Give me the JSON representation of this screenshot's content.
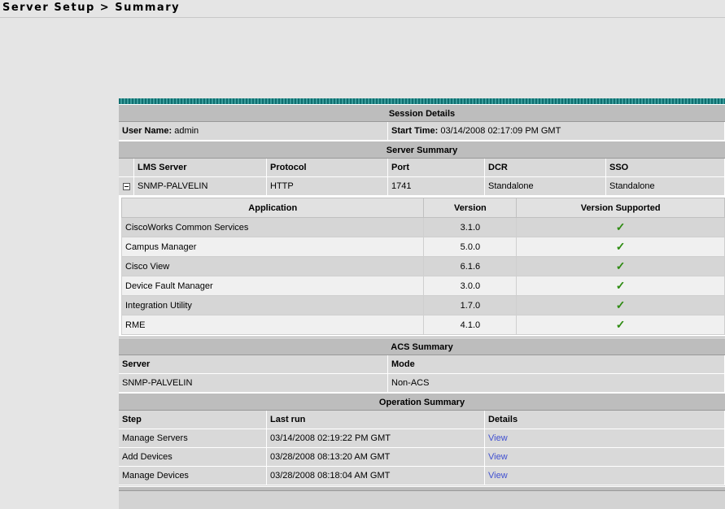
{
  "breadcrumb": "Server Setup > Summary",
  "session": {
    "title": "Session Details",
    "user_label": "User Name:",
    "user_value": "admin",
    "start_label": "Start Time:",
    "start_value": "03/14/2008 02:17:09 PM GMT"
  },
  "server_summary": {
    "title": "Server Summary",
    "columns": [
      "LMS Server",
      "Protocol",
      "Port",
      "DCR",
      "SSO"
    ],
    "row": [
      "SNMP-PALVELIN",
      "HTTP",
      "1741",
      "Standalone",
      "Standalone"
    ]
  },
  "applications": {
    "columns": [
      "Application",
      "Version",
      "Version Supported"
    ],
    "rows": [
      {
        "name": "CiscoWorks Common Services",
        "version": "3.1.0",
        "supported": "✓"
      },
      {
        "name": "Campus Manager",
        "version": "5.0.0",
        "supported": "✓"
      },
      {
        "name": "Cisco View",
        "version": "6.1.6",
        "supported": "✓"
      },
      {
        "name": "Device Fault Manager",
        "version": "3.0.0",
        "supported": "✓"
      },
      {
        "name": "Integration Utility",
        "version": "1.7.0",
        "supported": "✓"
      },
      {
        "name": "RME",
        "version": "4.1.0",
        "supported": "✓"
      }
    ],
    "check_color": "#2e8b12"
  },
  "acs": {
    "title": "ACS Summary",
    "columns": [
      "Server",
      "Mode"
    ],
    "row": [
      "SNMP-PALVELIN",
      "Non-ACS"
    ]
  },
  "operations": {
    "title": "Operation Summary",
    "columns": [
      "Step",
      "Last run",
      "Details"
    ],
    "rows": [
      {
        "step": "Manage Servers",
        "last_run": "03/14/2008 02:19:22 PM GMT",
        "details": "View"
      },
      {
        "step": "Add Devices",
        "last_run": "03/28/2008 08:13:20 AM GMT",
        "details": "View"
      },
      {
        "step": "Manage Devices",
        "last_run": "03/28/2008 08:18:04 AM GMT",
        "details": "View"
      }
    ],
    "link_color": "#4050d0"
  }
}
